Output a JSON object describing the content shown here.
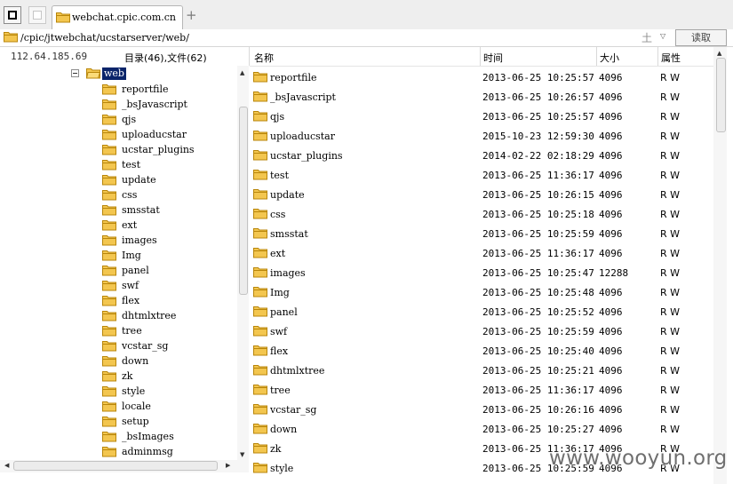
{
  "tab": {
    "title": "webchat.cpic.com.cn",
    "new_tab_symbol": "+"
  },
  "address": {
    "path": "/cpic/jtwebchat/ucstarserver/web/",
    "separator_symbol": "土",
    "dropdown_symbol": "▽",
    "read_button": "读取"
  },
  "header": {
    "ip": "112.64.185.69",
    "summary": "目录(46),文件(62)",
    "col_name": "名称",
    "col_time": "时间",
    "col_size": "大小",
    "col_attr": "属性"
  },
  "tree": {
    "root": "web",
    "items": [
      "reportfile",
      "_bsJavascript",
      "qjs",
      "uploaducstar",
      "ucstar_plugins",
      "test",
      "update",
      "css",
      "smsstat",
      "ext",
      "images",
      "Img",
      "panel",
      "swf",
      "flex",
      "dhtmlxtree",
      "tree",
      "vcstar_sg",
      "down",
      "zk",
      "style",
      "locale",
      "setup",
      "_bsImages",
      "adminmsg"
    ]
  },
  "files": [
    {
      "name": "reportfile",
      "time": "2013-06-25 10:25:57",
      "size": "4096",
      "attr": "R W"
    },
    {
      "name": "_bsJavascript",
      "time": "2013-06-25 10:26:57",
      "size": "4096",
      "attr": "R W"
    },
    {
      "name": "qjs",
      "time": "2013-06-25 10:25:57",
      "size": "4096",
      "attr": "R W"
    },
    {
      "name": "uploaducstar",
      "time": "2015-10-23 12:59:30",
      "size": "4096",
      "attr": "R W"
    },
    {
      "name": "ucstar_plugins",
      "time": "2014-02-22 02:18:29",
      "size": "4096",
      "attr": "R W"
    },
    {
      "name": "test",
      "time": "2013-06-25 11:36:17",
      "size": "4096",
      "attr": "R W"
    },
    {
      "name": "update",
      "time": "2013-06-25 10:26:15",
      "size": "4096",
      "attr": "R W"
    },
    {
      "name": "css",
      "time": "2013-06-25 10:25:18",
      "size": "4096",
      "attr": "R W"
    },
    {
      "name": "smsstat",
      "time": "2013-06-25 10:25:59",
      "size": "4096",
      "attr": "R W"
    },
    {
      "name": "ext",
      "time": "2013-06-25 11:36:17",
      "size": "4096",
      "attr": "R W"
    },
    {
      "name": "images",
      "time": "2013-06-25 10:25:47",
      "size": "12288",
      "attr": "R W"
    },
    {
      "name": "Img",
      "time": "2013-06-25 10:25:48",
      "size": "4096",
      "attr": "R W"
    },
    {
      "name": "panel",
      "time": "2013-06-25 10:25:52",
      "size": "4096",
      "attr": "R W"
    },
    {
      "name": "swf",
      "time": "2013-06-25 10:25:59",
      "size": "4096",
      "attr": "R W"
    },
    {
      "name": "flex",
      "time": "2013-06-25 10:25:40",
      "size": "4096",
      "attr": "R W"
    },
    {
      "name": "dhtmlxtree",
      "time": "2013-06-25 10:25:21",
      "size": "4096",
      "attr": "R W"
    },
    {
      "name": "tree",
      "time": "2013-06-25 11:36:17",
      "size": "4096",
      "attr": "R W"
    },
    {
      "name": "vcstar_sg",
      "time": "2013-06-25 10:26:16",
      "size": "4096",
      "attr": "R W"
    },
    {
      "name": "down",
      "time": "2013-06-25 10:25:27",
      "size": "4096",
      "attr": "R W"
    },
    {
      "name": "zk",
      "time": "2013-06-25 11:36:17",
      "size": "4096",
      "attr": "R W"
    },
    {
      "name": "style",
      "time": "2013-06-25 10:25:59",
      "size": "4096",
      "attr": "R W"
    }
  ],
  "watermark": "www.wooyun.org",
  "colors": {
    "selection": "#0a246a",
    "folder": "#f3c64f",
    "folder_edge": "#b8860b"
  }
}
